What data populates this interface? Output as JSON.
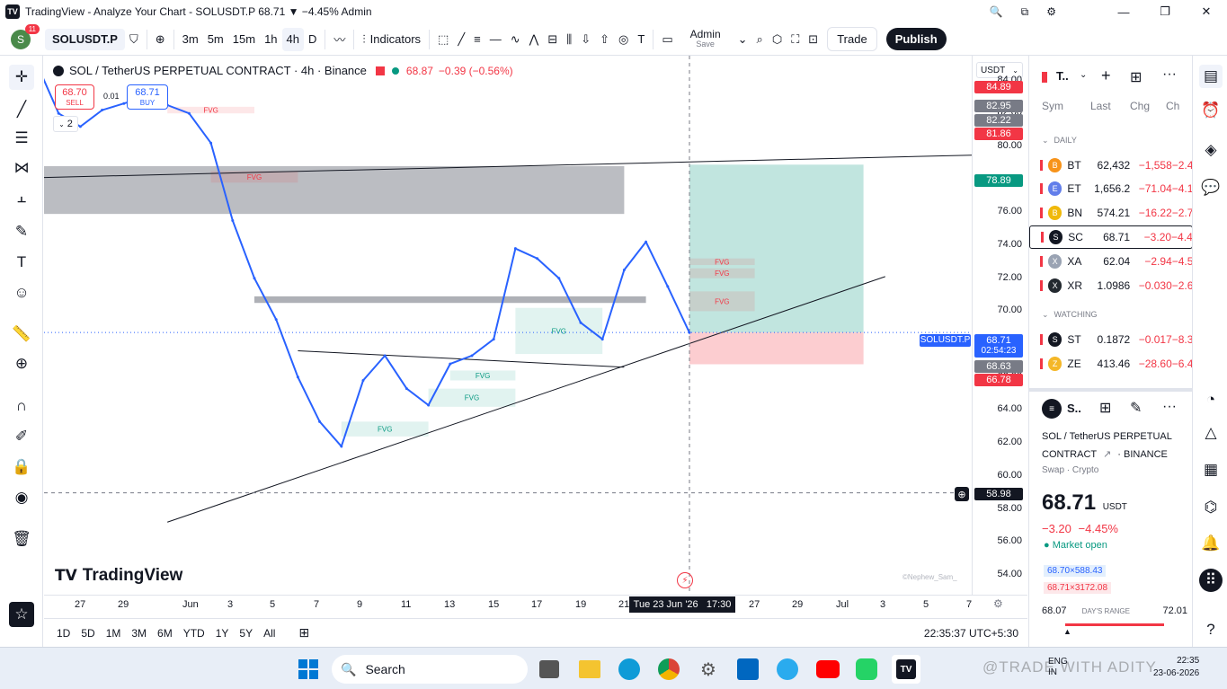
{
  "window": {
    "title": "TradingView - Analyze Your Chart - SOLUSDT.P 68.71 ▼ −4.45% Admin",
    "min": "—",
    "max": "❐",
    "close": "✕"
  },
  "toolbar": {
    "notifications": "11",
    "avatar_letter": "S",
    "symbol": "SOLUSDT.P",
    "intervals": [
      "3m",
      "5m",
      "15m",
      "1h",
      "4h"
    ],
    "interval_dropdown": "D",
    "indicators": "Indicators",
    "layout_name": "Admin",
    "layout_status": "Save",
    "trade": "Trade",
    "publish": "Publish"
  },
  "legend": {
    "symbol_line": "SOL / TetherUS PERPETUAL CONTRACT · 4h · Binance",
    "price": "68.87",
    "change": "−0.39 (−0.56%)",
    "sell_price": "68.70",
    "sell_label": "SELL",
    "spread": "0.01",
    "buy_price": "68.71",
    "buy_label": "BUY",
    "indicator_count": "2"
  },
  "chart": {
    "currency": "USDT",
    "watermark": "TradingView",
    "credit": "©Nephew_Sam_",
    "fvg_label": "FVG",
    "symbol_tag": "SOLUSDT.P",
    "countdown": "02:54:23",
    "crosshair_price": "58.98",
    "crosshair_date": "Tue 23 Jun '26   17:30",
    "price_labels": {
      "p8489": "84.89",
      "p8295": "82.95",
      "p8222": "82.22",
      "p8186": "81.86",
      "p7889": "78.89",
      "p6871": "68.71",
      "p6863": "68.63",
      "p6678": "66.78"
    },
    "colors": {
      "line": "#2962ff",
      "up": "#089981",
      "down": "#f23645"
    }
  },
  "chart_data": {
    "type": "line",
    "ylim": [
      52.8,
      85.5
    ],
    "y_ticks": [
      "84.00",
      "82.00",
      "80.00",
      "78.00",
      "76.00",
      "74.00",
      "72.00",
      "70.00",
      "68.00",
      "66.00",
      "64.00",
      "62.00",
      "60.00",
      "58.00",
      "56.00",
      "54.00"
    ],
    "x_ticks": [
      "27",
      "29",
      "Jun",
      "3",
      "5",
      "7",
      "9",
      "11",
      "13",
      "15",
      "17",
      "19",
      "21",
      "25",
      "27",
      "29",
      "Jul",
      "3",
      "5",
      "7"
    ],
    "x": [
      "2026-05-24",
      "2026-05-25",
      "2026-05-26",
      "2026-05-27",
      "2026-05-28",
      "2026-05-29",
      "2026-05-30",
      "2026-05-31",
      "2026-06-01",
      "2026-06-02",
      "2026-06-03",
      "2026-06-04",
      "2026-06-05",
      "2026-06-06",
      "2026-06-07",
      "2026-06-08",
      "2026-06-09",
      "2026-06-10",
      "2026-06-11",
      "2026-06-12",
      "2026-06-13",
      "2026-06-14",
      "2026-06-15",
      "2026-06-16",
      "2026-06-17",
      "2026-06-18",
      "2026-06-19",
      "2026-06-20",
      "2026-06-21",
      "2026-06-22",
      "2026-06-23"
    ],
    "series": [
      {
        "values": [
          85.0,
          82.0,
          81.2,
          82.2,
          82.6,
          83.0,
          82.5,
          82.0,
          80.2,
          75.5,
          72.0,
          69.5,
          66.0,
          63.3,
          61.8,
          65.8,
          67.3,
          65.3,
          64.3,
          66.8,
          67.3,
          68.3,
          73.8,
          73.2,
          72.0,
          69.3,
          68.3,
          72.5,
          74.2,
          71.5,
          68.7
        ]
      }
    ],
    "trendlines": [
      {
        "from": [
          "2026-05-24",
          78.1
        ],
        "to": [
          "2026-07-07",
          79.5
        ]
      },
      {
        "from": [
          "2026-05-30",
          57.2
        ],
        "to": [
          "2026-07-02",
          72.1
        ]
      },
      {
        "from": [
          "2026-06-05",
          67.6
        ],
        "to": [
          "2026-06-20",
          66.6
        ]
      }
    ],
    "zones": [
      {
        "kind": "supply",
        "x": [
          "2026-05-24",
          "2026-06-20"
        ],
        "y": [
          75.9,
          78.8
        ]
      },
      {
        "kind": "level",
        "x": [
          "2026-06-03",
          "2026-06-21"
        ],
        "y": [
          70.5,
          70.9
        ]
      },
      {
        "kind": "position-profit",
        "x": [
          "2026-06-23",
          "2026-07-01"
        ],
        "y": [
          68.71,
          78.89
        ]
      },
      {
        "kind": "position-loss",
        "x": [
          "2026-06-23",
          "2026-07-01"
        ],
        "y": [
          66.78,
          68.71
        ]
      }
    ],
    "fvg_bull": [
      {
        "x": [
          "2026-06-07",
          "2026-06-11"
        ],
        "y": [
          62.4,
          63.3
        ]
      },
      {
        "x": [
          "2026-06-11",
          "2026-06-15"
        ],
        "y": [
          64.2,
          65.3
        ]
      },
      {
        "x": [
          "2026-06-12",
          "2026-06-15"
        ],
        "y": [
          65.8,
          66.4
        ]
      },
      {
        "x": [
          "2026-06-15",
          "2026-06-19"
        ],
        "y": [
          67.4,
          70.2
        ]
      }
    ],
    "fvg_bear": [
      {
        "x": [
          "2026-05-30",
          "2026-06-03"
        ],
        "y": [
          82.0,
          82.4
        ]
      },
      {
        "x": [
          "2026-06-01",
          "2026-06-05"
        ],
        "y": [
          77.8,
          78.5
        ]
      },
      {
        "x": [
          "2026-06-23",
          "2026-06-26"
        ],
        "y": [
          72.8,
          73.2
        ]
      },
      {
        "x": [
          "2026-06-23",
          "2026-06-26"
        ],
        "y": [
          72.0,
          72.6
        ]
      },
      {
        "x": [
          "2026-06-23",
          "2026-06-26"
        ],
        "y": [
          70.0,
          71.2
        ]
      }
    ],
    "last_price": 68.71,
    "crosshair": {
      "x": "2026-06-23",
      "y": 58.98
    }
  },
  "bottombar": {
    "ranges": [
      "1D",
      "5D",
      "1M",
      "3M",
      "6M",
      "YTD",
      "1Y",
      "5Y",
      "All"
    ],
    "clock": "22:35:37 UTC+5:30"
  },
  "watchlist": {
    "title": "T..",
    "cols": [
      "Sym",
      "Last",
      "Chg",
      "Ch"
    ],
    "section_daily": "DAILY",
    "section_watching": "WATCHING",
    "rows": [
      {
        "sym": "BT",
        "last": "62,432",
        "chg": "−1,558",
        "pct": "−2.4",
        "color": "#f7931a",
        "glyph": "B"
      },
      {
        "sym": "ET",
        "last": "1,656.2",
        "chg": "−71.04",
        "pct": "−4.1",
        "color": "#627eea",
        "glyph": "E"
      },
      {
        "sym": "BN",
        "last": "574.21",
        "chg": "−16.22",
        "pct": "−2.7",
        "color": "#f0b90b",
        "glyph": "B"
      },
      {
        "sym": "SC",
        "last": "68.71",
        "chg": "−3.20",
        "pct": "−4.4",
        "color": "#131722",
        "glyph": "S"
      },
      {
        "sym": "XA",
        "last": "62.04",
        "chg": "−2.94",
        "pct": "−4.5",
        "color": "#9aa3b3",
        "glyph": "X"
      },
      {
        "sym": "XR",
        "last": "1.0986",
        "chg": "−0.030",
        "pct": "−2.6",
        "color": "#23292f",
        "glyph": "X"
      },
      {
        "sym": "ST",
        "last": "0.1872",
        "chg": "−0.017",
        "pct": "−8.3",
        "color": "#131722",
        "glyph": "S"
      },
      {
        "sym": "ZE",
        "last": "413.46",
        "chg": "−28.60",
        "pct": "−6.4",
        "color": "#f4b728",
        "glyph": "Z"
      }
    ]
  },
  "details": {
    "sym": "S..",
    "name_line1": "SOL / TetherUS PERPETUAL",
    "name_line2": "CONTRACT",
    "exchange": "· BINANCE",
    "kind": "Swap · Crypto",
    "price": "68.71",
    "currency": "USDT",
    "change": "−3.20",
    "change_pct": "−4.45%",
    "status": "Market open",
    "bid": "68.70×588.43",
    "ask": "68.71×3172.08",
    "day_low": "68.07",
    "day_label": "DAY'S RANGE",
    "day_high": "72.01"
  },
  "taskbar": {
    "search": "Search",
    "lang1": "ENG",
    "lang2": "IN",
    "time": "22:35",
    "date": "23-06-2026",
    "overlay": "@TRADE WITH ADITY"
  }
}
